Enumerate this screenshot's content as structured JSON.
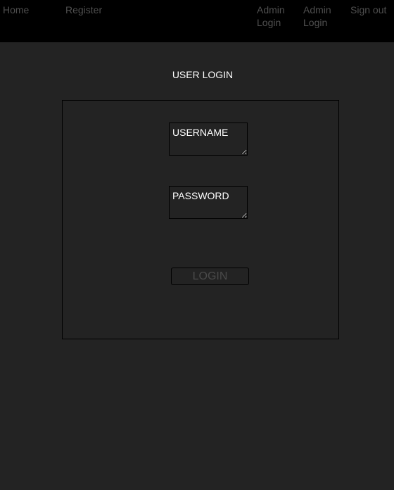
{
  "nav": {
    "home": "Home",
    "register": "Register",
    "admin_login_1": "Admin Login",
    "admin_login_2": "Admin Login",
    "sign_out": "Sign out"
  },
  "page": {
    "title": "USER LOGIN"
  },
  "form": {
    "username_placeholder": "USERNAME",
    "password_placeholder": "PASSWORD",
    "login_label": "LOGIN"
  },
  "colors": {
    "background": "#232323",
    "nav_background": "#000000",
    "nav_link": "#4f4f4f",
    "text": "#ffffff"
  }
}
